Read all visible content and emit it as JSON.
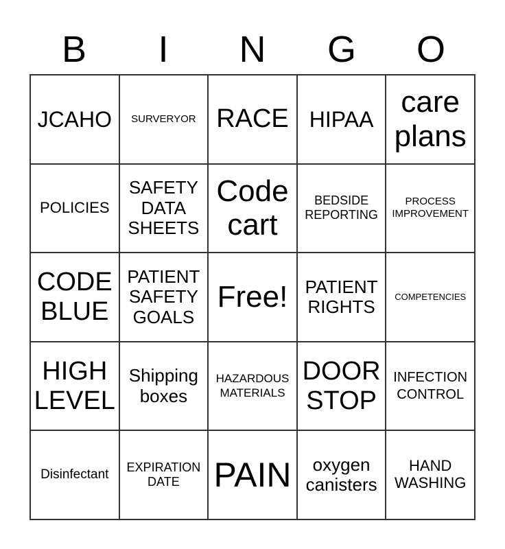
{
  "header": {
    "letters": [
      "B",
      "I",
      "N",
      "G",
      "O"
    ]
  },
  "cells": [
    [
      "JCAHO",
      "SURVERYOR",
      "RACE",
      "HIPAA",
      "care plans"
    ],
    [
      "POLICIES",
      "SAFETY DATA SHEETS",
      "Code cart",
      "BEDSIDE REPORTING",
      "PROCESS IMPROVEMENT"
    ],
    [
      "CODE BLUE",
      "PATIENT SAFETY GOALS",
      "Free!",
      "PATIENT RIGHTS",
      "COMPETENCIES"
    ],
    [
      "HIGH LEVEL",
      "Shipping boxes",
      "HAZARDOUS MATERIALS",
      "DOOR STOP",
      "INFECTION CONTROL"
    ],
    [
      "Disinfectant",
      "EXPIRATION DATE",
      "PAIN",
      "oxygen canisters",
      "HAND WASHING"
    ]
  ]
}
